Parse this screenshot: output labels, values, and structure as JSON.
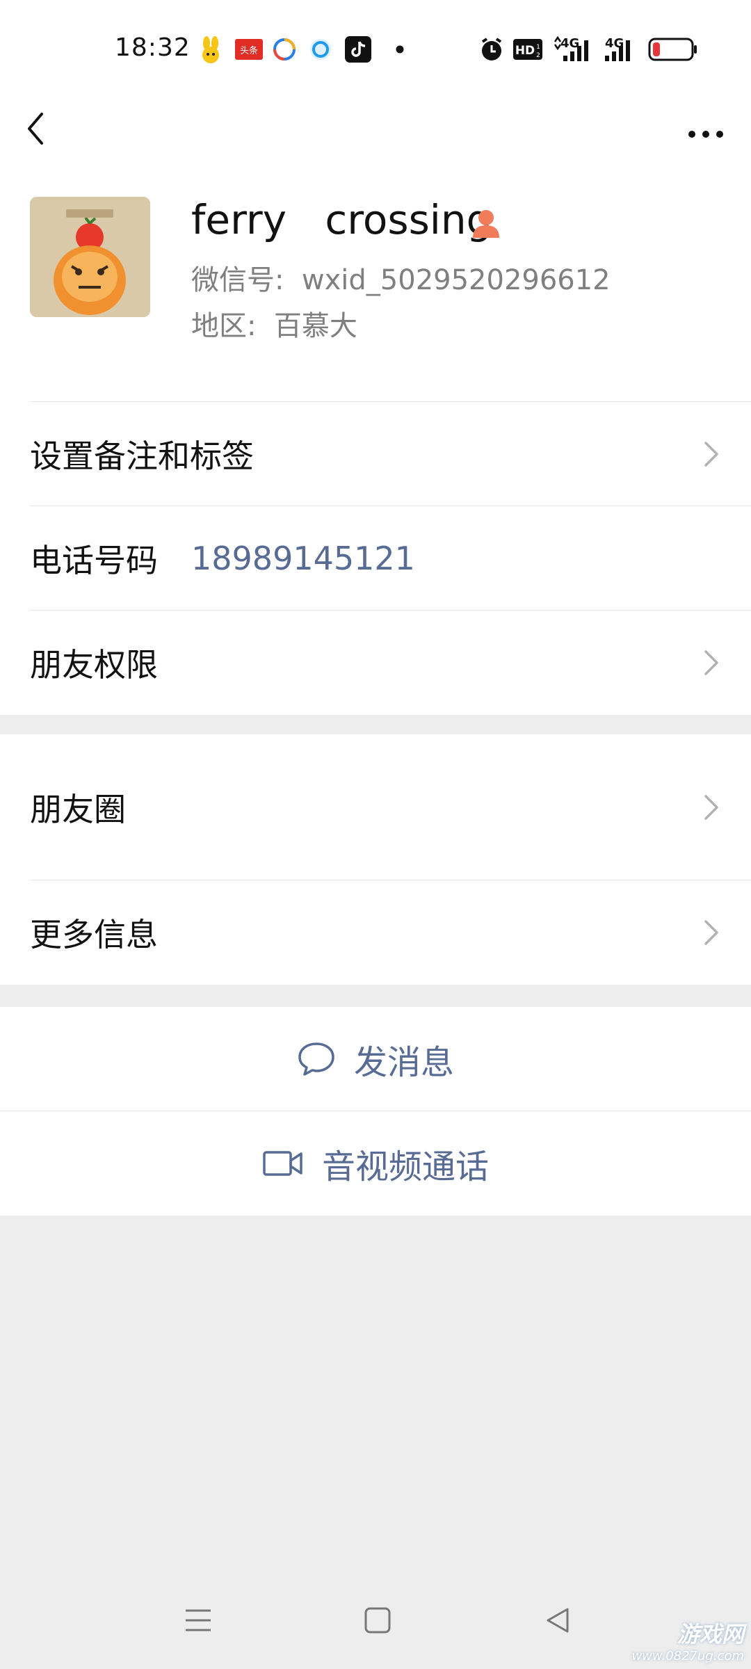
{
  "status_bar": {
    "time": "18:32",
    "hd_badge": "HD",
    "net1": "4G",
    "net2": "4G",
    "colors": {
      "battery_low": "#e5383b"
    },
    "notification_icons": [
      "rabbit-app-icon",
      "toutiao-icon",
      "browser-icon",
      "qq-browser-icon",
      "tiktok-icon",
      "dot-icon"
    ]
  },
  "profile": {
    "name": "ferry   crossing",
    "wechat_id": "微信号:  wxid_5029520296612",
    "region": "地区:  百慕大",
    "gender_color": "#f07c5a"
  },
  "rows_group1": [
    {
      "label": "设置备注和标签",
      "value": "",
      "has_arrow": true
    },
    {
      "label": "电话号码",
      "value": "18989145121",
      "has_arrow": false
    },
    {
      "label": "朋友权限",
      "value": "",
      "has_arrow": true
    }
  ],
  "rows_group2": [
    {
      "label": "朋友圈",
      "has_arrow": true
    },
    {
      "label": "更多信息",
      "has_arrow": true
    }
  ],
  "actions": {
    "send_message": "发消息",
    "av_call": "音视频通话"
  },
  "watermark": {
    "title": "游戏网",
    "url": "www.0827ug.com"
  },
  "colors": {
    "link_blue": "#576b95",
    "background": "#ededed"
  }
}
